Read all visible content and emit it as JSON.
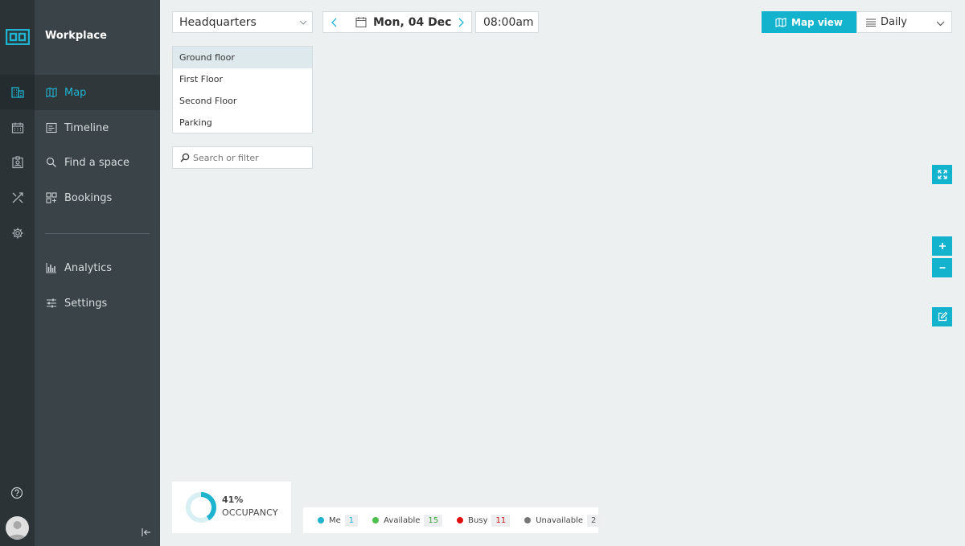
{
  "app": {
    "title": "Workplace"
  },
  "nav": {
    "items": [
      {
        "label": "Map",
        "icon": "map-icon",
        "active": true
      },
      {
        "label": "Timeline",
        "icon": "timeline-icon"
      },
      {
        "label": "Find a space",
        "icon": "search-icon"
      },
      {
        "label": "Bookings",
        "icon": "bookings-icon"
      },
      {
        "label": "Analytics",
        "icon": "analytics-icon"
      },
      {
        "label": "Settings",
        "icon": "settings-sliders-icon"
      }
    ]
  },
  "rail": {
    "icons": [
      "building-icon",
      "calendar-icon",
      "badge-icon",
      "tools-icon",
      "gear-icon"
    ],
    "help_icon": "help-icon",
    "collapse_icon": "collapse-icon"
  },
  "toolbar": {
    "location": "Headquarters",
    "date": "Mon, 04 Dec",
    "time": "08:00am",
    "map_view_label": "Map view",
    "period": "Daily"
  },
  "floors": {
    "items": [
      "Ground floor",
      "First Floor",
      "Second Floor",
      "Parking"
    ],
    "selected": "Ground floor"
  },
  "search": {
    "placeholder": "Search or filter"
  },
  "occupancy": {
    "percent_text": "41%",
    "label": "OCCUPANCY",
    "value": 0.41
  },
  "legend": [
    {
      "label": "Me",
      "count": "1",
      "color": "#1fb3cf",
      "count_color": "#1fb3cf"
    },
    {
      "label": "Available",
      "count": "15",
      "color": "#4cc04a",
      "count_color": "#3ba63a"
    },
    {
      "label": "Busy",
      "count": "11",
      "color": "#e01010",
      "count_color": "#d01818"
    },
    {
      "label": "Unavailable",
      "count": "2",
      "color": "#777777",
      "count_color": "#555555"
    }
  ],
  "colors": {
    "accent": "#13b3cd",
    "sidebar": "#3a4347",
    "rail": "#2b3337",
    "background": "#edf0f0"
  }
}
